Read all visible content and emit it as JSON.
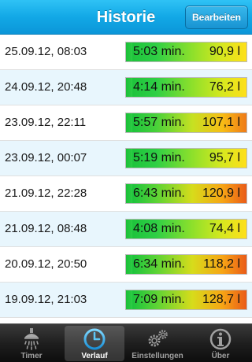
{
  "navbar": {
    "title": "Historie",
    "edit_label": "Bearbeiten"
  },
  "list": {
    "rows": [
      {
        "date": "25.09.12, 08:03",
        "duration": "5:03 min.",
        "volume": "90,9 l"
      },
      {
        "date": "24.09.12, 20:48",
        "duration": "4:14 min.",
        "volume": "76,2 l"
      },
      {
        "date": "23.09.12, 22:11",
        "duration": "5:57 min.",
        "volume": "107,1 l"
      },
      {
        "date": "23.09.12, 00:07",
        "duration": "5:19 min.",
        "volume": "95,7 l"
      },
      {
        "date": "21.09.12, 22:28",
        "duration": "6:43 min.",
        "volume": "120,9 l"
      },
      {
        "date": "21.09.12, 08:48",
        "duration": "4:08 min.",
        "volume": "74,4 l"
      },
      {
        "date": "20.09.12, 20:50",
        "duration": "6:34 min.",
        "volume": "118,2 l"
      },
      {
        "date": "19.09.12, 21:03",
        "duration": "7:09 min.",
        "volume": "128,7 l"
      }
    ]
  },
  "tabbar": {
    "tabs": [
      {
        "label": "Timer",
        "icon": "shower-icon"
      },
      {
        "label": "Verlauf",
        "icon": "clock-icon"
      },
      {
        "label": "Einstellungen",
        "icon": "gears-icon"
      },
      {
        "label": "Über",
        "icon": "info-icon"
      }
    ]
  },
  "colors": {
    "nav_blue": "#12a8e6",
    "row_alt": "#e8f6fd",
    "bar_green": "#1fc43c",
    "bar_yellow": "#ffdf19",
    "bar_orange": "#ea5b18"
  }
}
